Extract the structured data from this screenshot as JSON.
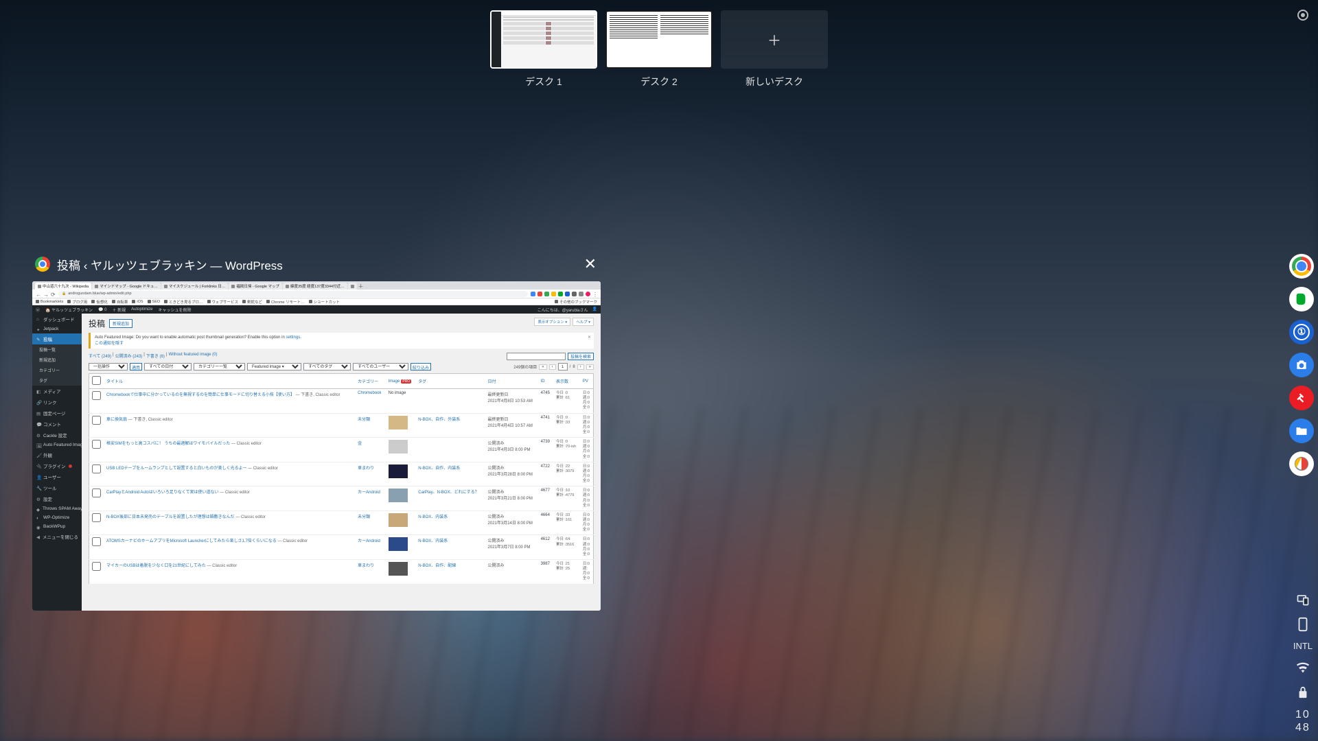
{
  "desks": {
    "items": [
      {
        "label": "デスク 1"
      },
      {
        "label": "デスク 2"
      }
    ],
    "new_label": "新しいデスク",
    "new_glyph": "＋"
  },
  "window": {
    "title": "投稿 ‹ ヤルッツェブラッキン — WordPress",
    "close_glyph": "✕"
  },
  "browser": {
    "tabs": [
      "中山道六十九次 - Wikipedia",
      "マインドマップ - Google ドキュ…",
      "マイスケジュール | Forklinks 日…",
      "福岡日帰 - Google マップ",
      "緯度35度 経度137度3344付近…",
      ""
    ],
    "url": "androgundam.blue/wp-admin/edit.php",
    "bookmarks": [
      "Bookmarklets",
      "ブログ用",
      "仮想化",
      "自転車",
      "iOS",
      "SEO",
      "ときどき見るブロ…",
      "ウェブサービス",
      "剣鉈など",
      "Chrome リモート…",
      "ショートカット"
    ],
    "other_bookmarks": "その他のブックマーク"
  },
  "wp": {
    "adminbar": {
      "site": "ヤルッツェブラッキン",
      "comments": "0",
      "new": "＋ 新規",
      "autoptimize": "Autoptimize",
      "cache": "キャッシュを削除",
      "howdy": "こんにちは、@yarublaさん"
    },
    "page_title": "投稿",
    "new_post": "新規追加",
    "screen_options": "表示オプション ▾",
    "help": "ヘルプ ▾",
    "notice": {
      "text_pre": "Auto Featured Image: Do you want to enable automatic post thumbnail generation? Enable this option in ",
      "link": "settings",
      "text_post": ".",
      "hide": "この通知を隠す"
    },
    "subsubsub": {
      "all": "すべて",
      "all_count": "(249)",
      "pub": "公開済み",
      "pub_count": "(243)",
      "draft": "下書き",
      "draft_count": "(6)",
      "nofeat": "Without featured image",
      "nofeat_count": "(0)"
    },
    "filters": {
      "bulk": "一括操作",
      "apply": "適用",
      "date": "すべての日付",
      "cat": "カテゴリー一覧",
      "feat": "Featured image ▾",
      "tag": "すべてのタグ",
      "user": "すべてのユーザー",
      "filter": "絞り込み"
    },
    "pagination": {
      "count_label": "249個の項目",
      "current": "1",
      "total": "8"
    },
    "search_btn": "投稿を検索",
    "columns": {
      "title": "タイトル",
      "cat": "カテゴリー",
      "image": "Image",
      "pro": "PRO",
      "tags": "タグ",
      "date": "日付",
      "id": "ID",
      "views": "表示数",
      "pv": "PV"
    },
    "menu": [
      {
        "label": "ダッシュボード",
        "ico": "⌂"
      },
      {
        "label": "Jetpack",
        "ico": "✦"
      },
      {
        "label": "投稿",
        "ico": "✎",
        "active": true
      },
      {
        "label": "投稿一覧",
        "sub": true
      },
      {
        "label": "新規追加",
        "sub": true
      },
      {
        "label": "カテゴリー",
        "sub": true
      },
      {
        "label": "タグ",
        "sub": true
      },
      {
        "label": "メディア",
        "ico": "◧"
      },
      {
        "label": "リンク",
        "ico": "🔗"
      },
      {
        "label": "固定ページ",
        "ico": "▤"
      },
      {
        "label": "コメント",
        "ico": "💬"
      },
      {
        "label": "Cackle 設定",
        "ico": "⚙"
      },
      {
        "label": "Auto Featured Image",
        "ico": "🖼"
      },
      {
        "label": "外観",
        "ico": "🖌"
      },
      {
        "label": "プラグイン",
        "ico": "🔌",
        "badge": "3"
      },
      {
        "label": "ユーザー",
        "ico": "👤"
      },
      {
        "label": "ツール",
        "ico": "🔧"
      },
      {
        "label": "設定",
        "ico": "⚙"
      },
      {
        "label": "Throws SPAM Away",
        "ico": "◆"
      },
      {
        "label": "WP-Optimize",
        "ico": "◐"
      },
      {
        "label": "BackWPup",
        "ico": "◉"
      },
      {
        "label": "メニューを閉じる",
        "ico": "◀"
      }
    ],
    "rows": [
      {
        "title": "Chromebookで仕事中に分かっているのを無視するのを簡単に仕事モードに切り替える小技【使い方】",
        "state": "— 下書き, Classic editor",
        "cat": "Chromebook",
        "img": "No image",
        "tags": "",
        "date_label": "最終更新日",
        "date": "2021年4月8日 10:53 AM",
        "id": "4745",
        "views_today": "0",
        "views_total": "61",
        "pv": "0"
      },
      {
        "title": "車に換気扇",
        "state": "— 下書き, Classic editor",
        "cat": "未分類",
        "thumb": "#d4b886",
        "tags": "N-BOX、自作、外装系",
        "date_label": "最終更新日",
        "date": "2021年4月4日 10:57 AM",
        "id": "4741",
        "views_today": "0",
        "views_total": "33",
        "pv": "0"
      },
      {
        "title": "格安SIMをもっと高コスパに！ うちの最適解はワイモバイルだった",
        "state": "— Classic editor",
        "cat": "金",
        "thumb": "",
        "tags": "",
        "date_label": "公開済み",
        "date": "2021年4月3日 8:00 PM",
        "id": "4739",
        "views_today": "0",
        "views_total": "70-ish",
        "pv": "0"
      },
      {
        "title": "USB LEDテープをルームランプとして設置すると白いものが美しく光るよー",
        "state": "— Classic editor",
        "cat": "車まわり",
        "thumb": "#1a1a3a",
        "tags": "N-BOX、自作、内装系",
        "date_label": "公開済み",
        "date": "2021年3月28日 8:00 PM",
        "id": "4722",
        "views_today": "22",
        "views_total": "3079",
        "pv": "0"
      },
      {
        "title": "CarPlayとAndroid Autoはいろいろ足りなくて実は使い道ない",
        "state": "— Classic editor",
        "cat": "カーAndroid",
        "thumb": "#88a0b0",
        "tags": "CarPlay、N-BOX、どれにする？",
        "date_label": "公開済み",
        "date": "2021年3月21日 8:00 PM",
        "id": "4677",
        "views_today": "10",
        "views_total": "4779",
        "pv": "0"
      },
      {
        "title": "N-BOX後部に日本未発売のテーブルを設置したが理想は鍋敷きなんだ",
        "state": "— Classic editor",
        "cat": "未分類",
        "thumb": "#c8a878",
        "tags": "N-BOX、内装系",
        "date_label": "公開済み",
        "date": "2021年3月14日 8:00 PM",
        "id": "4664",
        "views_today": "33",
        "views_total": "161",
        "pv": "0"
      },
      {
        "title": "ATOMSカーナビのホームアプリをMicrosoft Launcherにしてみたら楽しさ1.7倍くらいになる",
        "state": "— Classic editor",
        "cat": "カーAndroid",
        "thumb": "#2a4a8a",
        "tags": "N-BOX、内装系",
        "date_label": "公開済み",
        "date": "2021年3月7日 8:00 PM",
        "id": "4612",
        "views_today": "64",
        "views_total": "3516",
        "pv": "0"
      },
      {
        "title": "マイカーのUSBは着脱を少なく口を21世紀にしてみた",
        "state": "— Classic editor",
        "cat": "車まわり",
        "thumb": "#555",
        "tags": "N-BOX、自作、配線",
        "date_label": "公開済み",
        "date": "",
        "id": "3987",
        "views_today": "21",
        "views_total": "25",
        "pv": ""
      }
    ]
  },
  "shelf": {
    "items": [
      "chrome",
      "evernote",
      "onepass",
      "camera",
      "authy",
      "files",
      "cake"
    ]
  },
  "tray": {
    "ime": "INTL",
    "clock_h": "10",
    "clock_m": "48"
  }
}
